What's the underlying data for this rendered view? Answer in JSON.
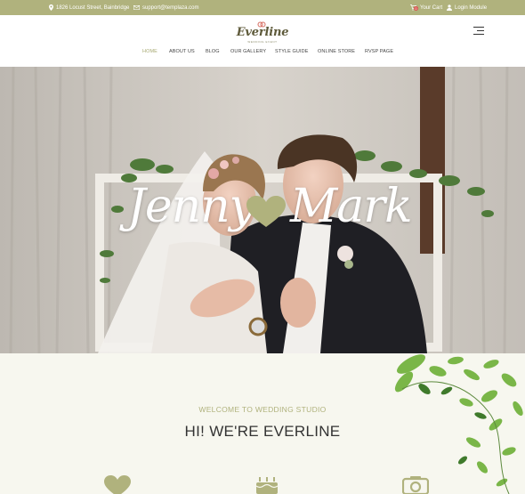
{
  "topbar": {
    "address": "1826 Locust Street, Bainbridge",
    "email": "support@templaza.com",
    "cart_label": "Your Cart",
    "cart_count": "0",
    "login_label": "Login Module",
    "colors": {
      "bar": "#b0b27d"
    }
  },
  "header": {
    "logo_text": "Everline",
    "logo_tagline": "WEDDING EVENT",
    "menu_icon": "hamburger-icon"
  },
  "nav": {
    "items": [
      {
        "label": "HOME",
        "active": true
      },
      {
        "label": "ABOUT US"
      },
      {
        "label": "BLOG"
      },
      {
        "label": "OUR GALLERY"
      },
      {
        "label": "STYLE GUIDE"
      },
      {
        "label": "ONLINE STORE"
      },
      {
        "label": "RVSP PAGE"
      }
    ],
    "active_color": "#a7a972"
  },
  "hero": {
    "bride_name": "Jenny",
    "groom_name": "Mark",
    "separator_icon": "heart-icon",
    "heart_color": "#b0b27d"
  },
  "welcome": {
    "kicker": "WELCOME TO WEDDING STUDIO",
    "title": "HI! WE'RE EVERLINE",
    "feature_icons": [
      "heart-icon",
      "cake-icon",
      "camera-icon"
    ],
    "accent": "#b0b27d"
  }
}
